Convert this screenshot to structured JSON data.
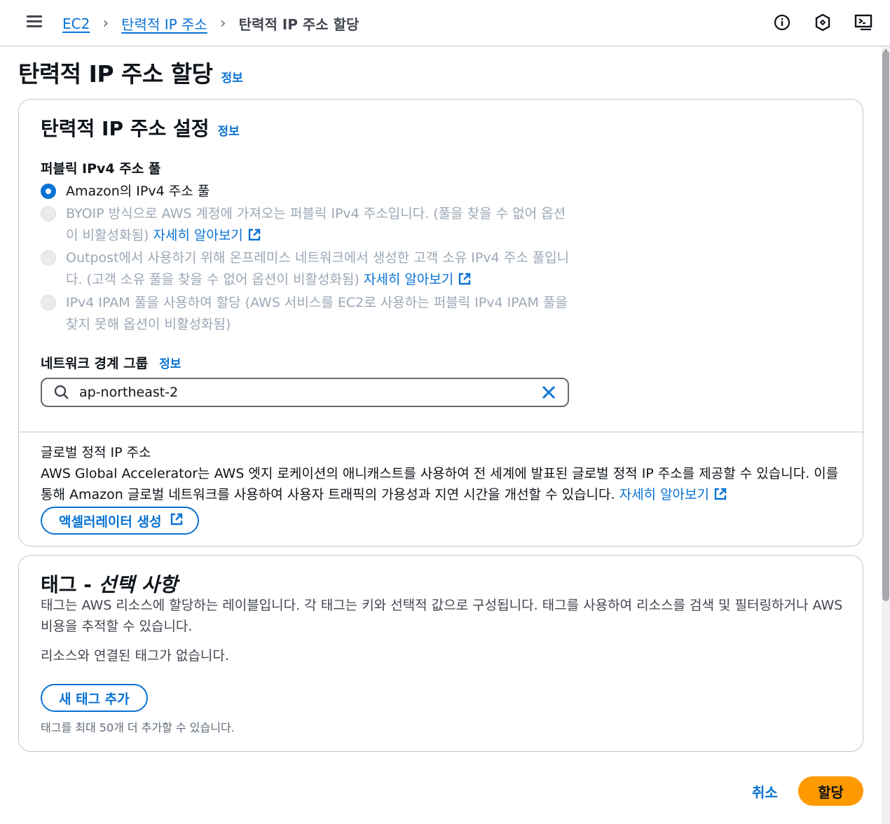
{
  "header": {
    "breadcrumbs": [
      "EC2",
      "탄력적 IP 주소",
      "탄력적 IP 주소 할당"
    ],
    "icons": [
      "menu-icon",
      "info-circle-icon",
      "notification-icon",
      "cloudshell-icon"
    ]
  },
  "page": {
    "title": "탄력적 IP 주소 할당",
    "info": "정보"
  },
  "settings": {
    "title": "탄력적 IP 주소 설정",
    "info": "정보",
    "pool_label": "퍼블릭 IPv4 주소 풀",
    "options": [
      {
        "text": "Amazon의 IPv4 주소 풀",
        "selected": true,
        "disabled": false
      },
      {
        "text": "BYOIP 방식으로 AWS 계정에 가져오는 퍼블릭 IPv4 주소입니다. (풀을 찾을 수 없어 옵션이 비활성화됨)",
        "link": "자세히 알아보기",
        "selected": false,
        "disabled": true
      },
      {
        "text": "Outpost에서 사용하기 위해 온프레미스 네트워크에서 생성한 고객 소유 IPv4 주소 풀입니다. (고객 소유 풀을 찾을 수 없어 옵션이 비활성화됨)",
        "link": "자세히 알아보기",
        "selected": false,
        "disabled": true
      },
      {
        "text": "IPv4 IPAM 풀을 사용하여 할당 (AWS 서비스를 EC2로 사용하는 퍼블릭 IPv4 IPAM 풀을 찾지 못해 옵션이 비활성화됨)",
        "selected": false,
        "disabled": true
      }
    ],
    "nbg_label": "네트워크 경계 그룹",
    "nbg_info": "정보",
    "nbg_value": "ap-northeast-2"
  },
  "global": {
    "heading": "글로벌 정적 IP 주소",
    "description": "AWS Global Accelerator는 AWS 엣지 로케이션의 애니캐스트를 사용하여 전 세계에 발표된 글로벌 정적 IP 주소를 제공할 수 있습니다. 이를 통해 Amazon 글로벌 네트워크를 사용하여 사용자 트래픽의 가용성과 지연 시간을 개선할 수 있습니다.",
    "link": "자세히 알아보기",
    "button": "액셀러레이터 생성"
  },
  "tags": {
    "title_main": "태그 - ",
    "title_italic": "선택 사항",
    "description": "태그는 AWS 리소스에 할당하는 레이블입니다. 각 태그는 키와 선택적 값으로 구성됩니다. 태그를 사용하여 리소스를 검색 및 필터링하거나 AWS 비용을 추적할 수 있습니다.",
    "empty": "리소스와 연결된 태그가 없습니다.",
    "add_button": "새 태그 추가",
    "limit": "태그를 최대 50개 더 추가할 수 있습니다."
  },
  "footer": {
    "cancel": "취소",
    "submit": "할당"
  },
  "colors": {
    "link": "#0972d3",
    "primary": "#ff9900",
    "disabled_text": "#9ba7b6",
    "border": "#c6c6cd"
  }
}
